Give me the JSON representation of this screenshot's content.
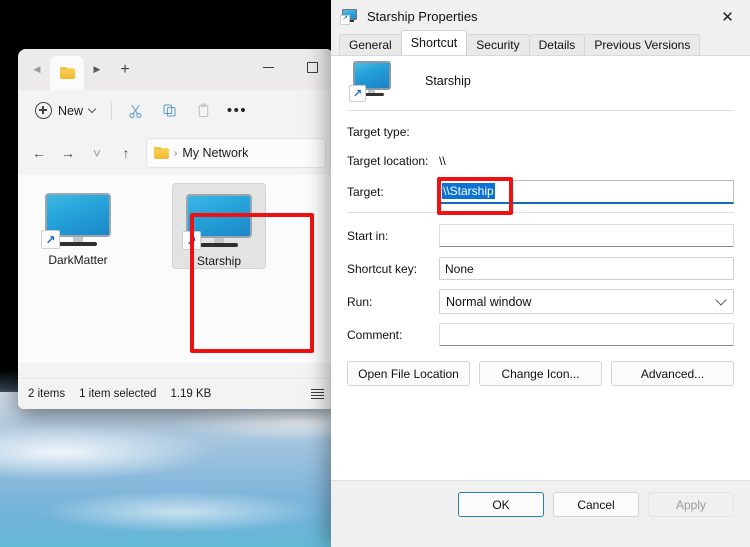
{
  "explorer": {
    "tab": {
      "icon": "folder-icon"
    },
    "tab_nav": {
      "back": "◀",
      "forward": "▶",
      "new_tab": "+"
    },
    "window_controls": {
      "minimize": "minimize-icon",
      "maximize": "maximize-icon"
    },
    "toolbar": {
      "new_label": "New",
      "cut_label": "Cut",
      "copy_label": "Copy",
      "paste_label": "Paste",
      "more_label": "See more"
    },
    "address": {
      "back": "←",
      "forward": "→",
      "recent": "˅",
      "up": "↑",
      "crumb_sep": "›",
      "crumb": "My Network"
    },
    "items": [
      {
        "label": "DarkMatter",
        "selected": false
      },
      {
        "label": "Starship",
        "selected": true
      }
    ],
    "status": {
      "count": "2 items",
      "selection": "1 item selected",
      "size": "1.19 KB"
    }
  },
  "properties": {
    "title": "Starship Properties",
    "close": "✕",
    "tabs": [
      {
        "label": "General",
        "active": false
      },
      {
        "label": "Shortcut",
        "active": true
      },
      {
        "label": "Security",
        "active": false
      },
      {
        "label": "Details",
        "active": false
      },
      {
        "label": "Previous Versions",
        "active": false
      }
    ],
    "header_name": "Starship",
    "fields": {
      "target_type_label": "Target type:",
      "target_type_value": "",
      "target_location_label": "Target location:",
      "target_location_value": "\\\\",
      "target_label": "Target:",
      "target_value": "\\\\Starship",
      "start_in_label": "Start in:",
      "start_in_value": "",
      "shortcut_key_label": "Shortcut key:",
      "shortcut_key_value": "None",
      "run_label": "Run:",
      "run_value": "Normal window",
      "comment_label": "Comment:",
      "comment_value": ""
    },
    "action_buttons": [
      {
        "label": "Open File Location"
      },
      {
        "label": "Change Icon..."
      },
      {
        "label": "Advanced..."
      }
    ],
    "footer_buttons": [
      {
        "label": "OK",
        "state": "default"
      },
      {
        "label": "Cancel",
        "state": "normal"
      },
      {
        "label": "Apply",
        "state": "disabled"
      }
    ]
  },
  "annotations": {
    "icon_highlight": "red-rectangle-around-starship-icon",
    "target_highlight": "red-rectangle-around-target-field"
  },
  "colors": {
    "accent": "#0f6cbd",
    "selection": "#0a72d4",
    "annotation": "#ef1111"
  }
}
